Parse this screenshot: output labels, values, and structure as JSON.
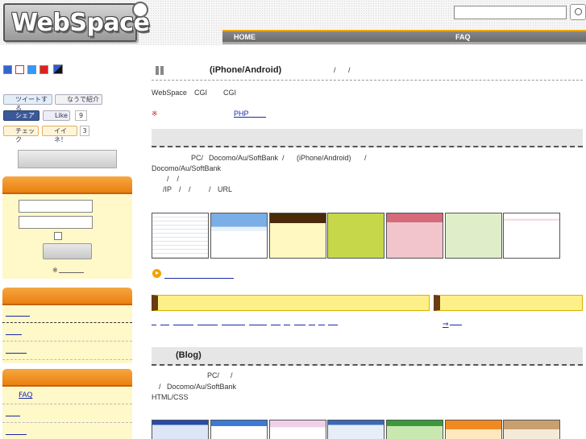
{
  "header": {
    "logo_text": "WebSpace",
    "search_placeholder": "",
    "nav": {
      "home": "HOME",
      "faq": "FAQ"
    }
  },
  "sidebar": {
    "tweet_label": "ツイートする",
    "naude_label": "なうで紹介",
    "share_label": "シェア",
    "like_label": "Like",
    "like_count": "9",
    "check_label": "チェック",
    "iine_label": "イイネ！",
    "iine_count": "3",
    "login_note": "※",
    "faq_label": "FAQ"
  },
  "main": {
    "title1": "(iPhone/Android)",
    "title1_slash1": "/",
    "title1_slash2": "/",
    "intro_a": "WebSpace",
    "intro_b": "CGI",
    "intro_c": "CGI",
    "note_mark": "※",
    "php_link": "PHP",
    "desc1_line1_a": "PC/",
    "desc1_line1_b": "Docomo/Au/SoftBank",
    "desc1_line1_c": "/",
    "desc1_line1_d": "(iPhone/Android)",
    "desc1_line1_e": "/",
    "desc1_line2": "Docomo/Au/SoftBank",
    "desc1_line3": "/    /",
    "desc1_line4_a": "/IP",
    "desc1_line4_b": "/",
    "desc1_line4_c": "/",
    "desc1_line4_d": "/",
    "desc1_line4_e": "URL",
    "arrow_link": "⇒",
    "title2": "(Blog)",
    "desc2_line1_a": "PC/",
    "desc2_line1_b": "/",
    "desc2_line2": "/   Docomo/Au/SoftBank",
    "desc2_line3": "HTML/CSS"
  },
  "colors": {
    "accent_orange": "#e87c0a",
    "sidebar_bg": "#fff8c8",
    "nav_gray": "#777777",
    "link_blue": "#1a2aa8"
  }
}
